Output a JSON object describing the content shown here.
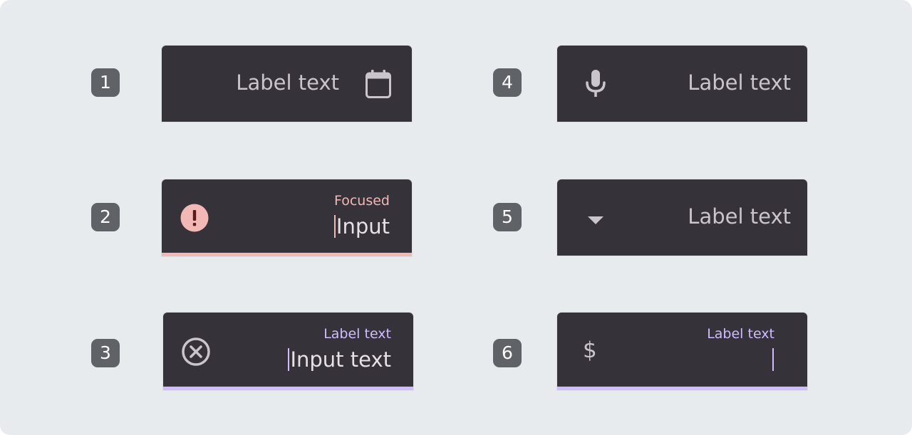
{
  "colors": {
    "surface": "#36323a",
    "on_surface_variant": "#cac5cd",
    "on_surface": "#e6e1e5",
    "error": "#f2b8b5",
    "primary": "#cfbcff",
    "badge": "#5f6368",
    "background": "#e7ebee"
  },
  "fields": [
    {
      "number": "1",
      "label": "Label text",
      "trailing_icon": "calendar-icon"
    },
    {
      "number": "2",
      "label": "Focused",
      "input": "Input",
      "leading_icon": "error-icon",
      "state": "error"
    },
    {
      "number": "3",
      "label": "Label text",
      "input": "Input text",
      "leading_icon": "cancel-circle-icon",
      "state": "focused"
    },
    {
      "number": "4",
      "label": "Label text",
      "leading_icon": "microphone-icon"
    },
    {
      "number": "5",
      "label": "Label text",
      "leading_icon": "dropdown-arrow-icon"
    },
    {
      "number": "6",
      "label": "Label text",
      "input": "",
      "prefix": "$",
      "state": "focused"
    }
  ]
}
